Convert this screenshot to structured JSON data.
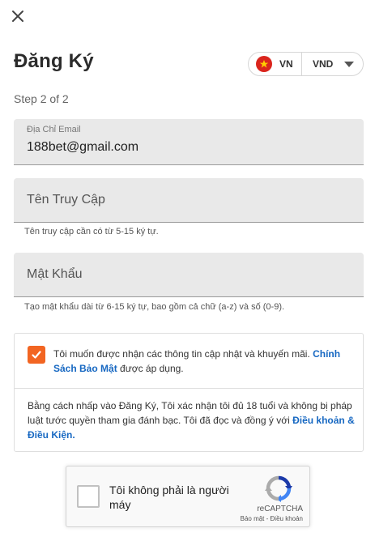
{
  "header": {
    "title": "Đăng Ký",
    "close_icon": "close-icon"
  },
  "locale": {
    "country_code": "VN",
    "flag_icon": "vietnam-flag-icon",
    "currency_code": "VND",
    "caret_icon": "caret-down-icon"
  },
  "step": {
    "label": "Step 2 of 2"
  },
  "form": {
    "email": {
      "label": "Địa Chỉ Email",
      "value": "188bet@gmail.com"
    },
    "username": {
      "placeholder": "Tên Truy Cập",
      "helper": "Tên truy cập cần có từ 5-15 ký tự."
    },
    "password": {
      "placeholder": "Mật Khẩu",
      "helper": "Tạo mật khẩu dài từ 6-15 ký tự, bao gồm cả chữ (a-z) và số (0-9)."
    }
  },
  "consent": {
    "checked": true,
    "text_before": "Tôi muốn được nhận các thông tin cập nhật và khuyến mãi. ",
    "link": "Chính Sách Bảo Mật",
    "text_after": " được áp dụng."
  },
  "agreement": {
    "text": "Bằng cách nhấp vào Đăng Ký, Tôi xác nhận tôi đủ 18 tuổi và không bị pháp luật tước quyền tham gia đánh bạc. Tôi đã đọc và đồng ý với ",
    "link": "Điều khoản & Điều Kiện."
  },
  "captcha": {
    "label": "Tôi không phải là người máy",
    "brand": "reCAPTCHA",
    "privacy_link": "Bảo mật",
    "separator": " - ",
    "terms_link": "Điều khoản"
  },
  "colors": {
    "accent": "#f26522",
    "link": "#1768c2",
    "field_bg": "#e9e9e9"
  }
}
